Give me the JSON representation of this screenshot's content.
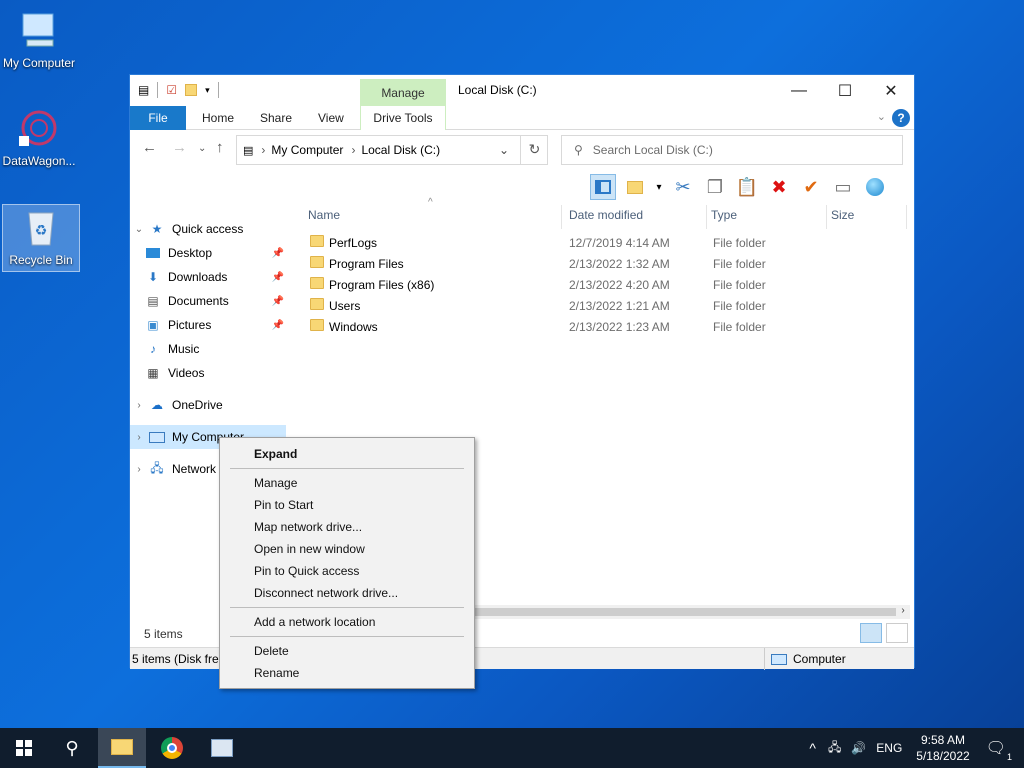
{
  "desktop": {
    "icons": [
      {
        "label": "My Computer"
      },
      {
        "label": "DataWagon..."
      },
      {
        "label": "Recycle Bin"
      }
    ]
  },
  "window": {
    "title": "Local Disk (C:)",
    "contextual_tab_header": "Manage",
    "ribbon_tabs": [
      "File",
      "Home",
      "Share",
      "View",
      "Drive Tools"
    ],
    "help_glyph": "?",
    "controls": {
      "minimize": "—",
      "maximize": "☐",
      "close": "✕"
    }
  },
  "address": {
    "crumbs": [
      "My Computer",
      "Local Disk (C:)"
    ],
    "search_placeholder": "Search Local Disk (C:)"
  },
  "navpane": {
    "items": [
      {
        "label": "Quick access",
        "icon": "star-icon"
      },
      {
        "label": "Desktop",
        "icon": "desktop-icon"
      },
      {
        "label": "Downloads",
        "icon": "download-icon"
      },
      {
        "label": "Documents",
        "icon": "document-icon"
      },
      {
        "label": "Pictures",
        "icon": "picture-icon"
      },
      {
        "label": "Music",
        "icon": "music-icon"
      },
      {
        "label": "Videos",
        "icon": "video-icon"
      },
      {
        "label": "OneDrive",
        "icon": "cloud-icon"
      },
      {
        "label": "My Computer",
        "icon": "computer-icon"
      },
      {
        "label": "Network",
        "icon": "network-icon"
      }
    ]
  },
  "columns": [
    "Name",
    "Date modified",
    "Type",
    "Size"
  ],
  "files": [
    {
      "name": "PerfLogs",
      "date": "12/7/2019 4:14 AM",
      "type": "File folder"
    },
    {
      "name": "Program Files",
      "date": "2/13/2022 1:32 AM",
      "type": "File folder"
    },
    {
      "name": "Program Files (x86)",
      "date": "2/13/2022 4:20 AM",
      "type": "File folder"
    },
    {
      "name": "Users",
      "date": "2/13/2022 1:21 AM",
      "type": "File folder"
    },
    {
      "name": "Windows",
      "date": "2/13/2022 1:23 AM",
      "type": "File folder"
    }
  ],
  "status": {
    "count": "5 items",
    "bottom_left": "5 items (Disk free",
    "bottom_right": "Computer"
  },
  "context_menu": {
    "items": [
      {
        "label": "Expand",
        "bold": true
      },
      {
        "label": "Manage"
      },
      {
        "label": "Pin to Start"
      },
      {
        "label": "Map network drive..."
      },
      {
        "label": "Open in new window"
      },
      {
        "label": "Pin to Quick access"
      },
      {
        "label": "Disconnect network drive..."
      },
      {
        "label": "Add a network location"
      },
      {
        "label": "Delete"
      },
      {
        "label": "Rename"
      }
    ]
  },
  "taskbar": {
    "language": "ENG",
    "time": "9:58 AM",
    "date": "5/18/2022",
    "notification_count": "1"
  }
}
